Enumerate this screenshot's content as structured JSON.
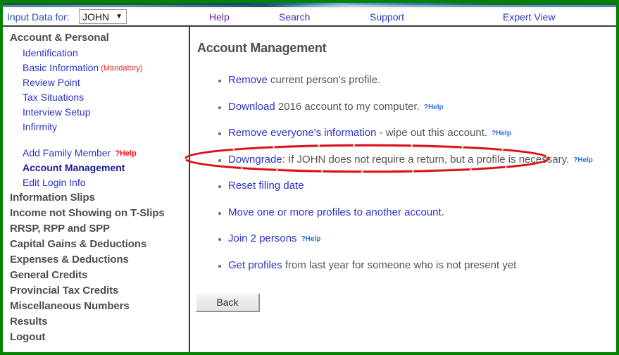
{
  "header": {
    "input_label": "Input Data for:",
    "selected_person": "JOHN",
    "caret": "▼",
    "nav": [
      {
        "label": "Help"
      },
      {
        "label": "Search"
      },
      {
        "label": "Support"
      },
      {
        "label": "Expert View"
      }
    ]
  },
  "sidebar": {
    "groups": [
      {
        "label": "Account & Personal"
      }
    ],
    "links": [
      {
        "label": "Identification"
      },
      {
        "label": "Basic Information",
        "suffix": "(Mandatory)"
      },
      {
        "label": "Review Point"
      },
      {
        "label": "Tax Situations"
      },
      {
        "label": "Interview Setup"
      },
      {
        "label": "Infirmity"
      },
      {
        "label": "Add Family Member",
        "help": "?Help"
      },
      {
        "label": "Account Management",
        "active": true
      },
      {
        "label": "Edit Login Info"
      }
    ],
    "sections": [
      {
        "label": "Information Slips"
      },
      {
        "label": "Income not Showing on T-Slips"
      },
      {
        "label": "RRSP, RPP and SPP"
      },
      {
        "label": "Capital Gains & Deductions"
      },
      {
        "label": "Expenses & Deductions"
      },
      {
        "label": "General Credits"
      },
      {
        "label": "Provincial Tax Credits"
      },
      {
        "label": "Miscellaneous Numbers"
      },
      {
        "label": "Results"
      },
      {
        "label": "Logout"
      }
    ]
  },
  "main": {
    "title": "Account Management",
    "actions": [
      {
        "link": "Remove",
        "rest": " current person's profile.",
        "help": ""
      },
      {
        "link": "Download",
        "rest": " 2016 account to my computer.",
        "help": "?Help"
      },
      {
        "link": "Remove everyone's information",
        "rest": " - wipe out this account.",
        "help": "?Help",
        "highlighted": true
      },
      {
        "link": "Downgrade",
        "rest": ": If JOHN does not require a return, but a profile is necessary.",
        "help": "?Help"
      },
      {
        "link": "Reset filing date",
        "rest": "",
        "help": ""
      },
      {
        "link": "Move one or more profiles to another account.",
        "rest": "",
        "help": ""
      },
      {
        "link": "Join 2 persons",
        "rest": "",
        "help": "?Help"
      },
      {
        "link": "Get profiles",
        "rest": " from last year for someone who is not present yet",
        "help": ""
      }
    ],
    "back_label": "Back"
  },
  "annotation": {
    "shape": "ellipse",
    "color": "#d81016",
    "target": "Remove everyone's information - wipe out this account."
  },
  "colors": {
    "frame_green": "#068203",
    "link_blue": "#2b33c9",
    "visited_purple": "#6b21a8",
    "heading_gray": "#4d4d4d",
    "help_red": "#ee1111",
    "help_blue": "#2b6fd8",
    "annotation_red": "#d81016"
  }
}
